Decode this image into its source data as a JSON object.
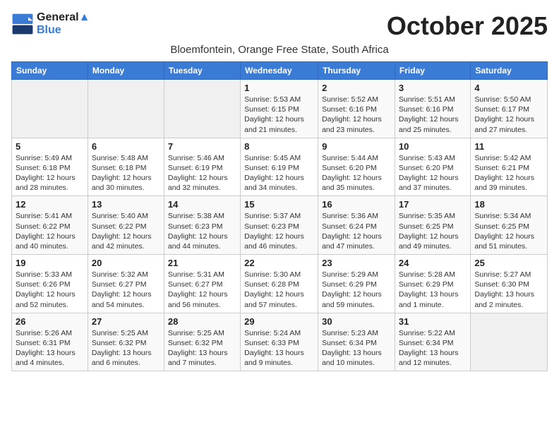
{
  "logo": {
    "line1": "General",
    "line2": "Blue"
  },
  "title": "October 2025",
  "location": "Bloemfontein, Orange Free State, South Africa",
  "days_of_week": [
    "Sunday",
    "Monday",
    "Tuesday",
    "Wednesday",
    "Thursday",
    "Friday",
    "Saturday"
  ],
  "weeks": [
    [
      {
        "day": "",
        "info": ""
      },
      {
        "day": "",
        "info": ""
      },
      {
        "day": "",
        "info": ""
      },
      {
        "day": "1",
        "info": "Sunrise: 5:53 AM\nSunset: 6:15 PM\nDaylight: 12 hours\nand 21 minutes."
      },
      {
        "day": "2",
        "info": "Sunrise: 5:52 AM\nSunset: 6:16 PM\nDaylight: 12 hours\nand 23 minutes."
      },
      {
        "day": "3",
        "info": "Sunrise: 5:51 AM\nSunset: 6:16 PM\nDaylight: 12 hours\nand 25 minutes."
      },
      {
        "day": "4",
        "info": "Sunrise: 5:50 AM\nSunset: 6:17 PM\nDaylight: 12 hours\nand 27 minutes."
      }
    ],
    [
      {
        "day": "5",
        "info": "Sunrise: 5:49 AM\nSunset: 6:18 PM\nDaylight: 12 hours\nand 28 minutes."
      },
      {
        "day": "6",
        "info": "Sunrise: 5:48 AM\nSunset: 6:18 PM\nDaylight: 12 hours\nand 30 minutes."
      },
      {
        "day": "7",
        "info": "Sunrise: 5:46 AM\nSunset: 6:19 PM\nDaylight: 12 hours\nand 32 minutes."
      },
      {
        "day": "8",
        "info": "Sunrise: 5:45 AM\nSunset: 6:19 PM\nDaylight: 12 hours\nand 34 minutes."
      },
      {
        "day": "9",
        "info": "Sunrise: 5:44 AM\nSunset: 6:20 PM\nDaylight: 12 hours\nand 35 minutes."
      },
      {
        "day": "10",
        "info": "Sunrise: 5:43 AM\nSunset: 6:20 PM\nDaylight: 12 hours\nand 37 minutes."
      },
      {
        "day": "11",
        "info": "Sunrise: 5:42 AM\nSunset: 6:21 PM\nDaylight: 12 hours\nand 39 minutes."
      }
    ],
    [
      {
        "day": "12",
        "info": "Sunrise: 5:41 AM\nSunset: 6:22 PM\nDaylight: 12 hours\nand 40 minutes."
      },
      {
        "day": "13",
        "info": "Sunrise: 5:40 AM\nSunset: 6:22 PM\nDaylight: 12 hours\nand 42 minutes."
      },
      {
        "day": "14",
        "info": "Sunrise: 5:38 AM\nSunset: 6:23 PM\nDaylight: 12 hours\nand 44 minutes."
      },
      {
        "day": "15",
        "info": "Sunrise: 5:37 AM\nSunset: 6:23 PM\nDaylight: 12 hours\nand 46 minutes."
      },
      {
        "day": "16",
        "info": "Sunrise: 5:36 AM\nSunset: 6:24 PM\nDaylight: 12 hours\nand 47 minutes."
      },
      {
        "day": "17",
        "info": "Sunrise: 5:35 AM\nSunset: 6:25 PM\nDaylight: 12 hours\nand 49 minutes."
      },
      {
        "day": "18",
        "info": "Sunrise: 5:34 AM\nSunset: 6:25 PM\nDaylight: 12 hours\nand 51 minutes."
      }
    ],
    [
      {
        "day": "19",
        "info": "Sunrise: 5:33 AM\nSunset: 6:26 PM\nDaylight: 12 hours\nand 52 minutes."
      },
      {
        "day": "20",
        "info": "Sunrise: 5:32 AM\nSunset: 6:27 PM\nDaylight: 12 hours\nand 54 minutes."
      },
      {
        "day": "21",
        "info": "Sunrise: 5:31 AM\nSunset: 6:27 PM\nDaylight: 12 hours\nand 56 minutes."
      },
      {
        "day": "22",
        "info": "Sunrise: 5:30 AM\nSunset: 6:28 PM\nDaylight: 12 hours\nand 57 minutes."
      },
      {
        "day": "23",
        "info": "Sunrise: 5:29 AM\nSunset: 6:29 PM\nDaylight: 12 hours\nand 59 minutes."
      },
      {
        "day": "24",
        "info": "Sunrise: 5:28 AM\nSunset: 6:29 PM\nDaylight: 13 hours\nand 1 minute."
      },
      {
        "day": "25",
        "info": "Sunrise: 5:27 AM\nSunset: 6:30 PM\nDaylight: 13 hours\nand 2 minutes."
      }
    ],
    [
      {
        "day": "26",
        "info": "Sunrise: 5:26 AM\nSunset: 6:31 PM\nDaylight: 13 hours\nand 4 minutes."
      },
      {
        "day": "27",
        "info": "Sunrise: 5:25 AM\nSunset: 6:32 PM\nDaylight: 13 hours\nand 6 minutes."
      },
      {
        "day": "28",
        "info": "Sunrise: 5:25 AM\nSunset: 6:32 PM\nDaylight: 13 hours\nand 7 minutes."
      },
      {
        "day": "29",
        "info": "Sunrise: 5:24 AM\nSunset: 6:33 PM\nDaylight: 13 hours\nand 9 minutes."
      },
      {
        "day": "30",
        "info": "Sunrise: 5:23 AM\nSunset: 6:34 PM\nDaylight: 13 hours\nand 10 minutes."
      },
      {
        "day": "31",
        "info": "Sunrise: 5:22 AM\nSunset: 6:34 PM\nDaylight: 13 hours\nand 12 minutes."
      },
      {
        "day": "",
        "info": ""
      }
    ]
  ]
}
